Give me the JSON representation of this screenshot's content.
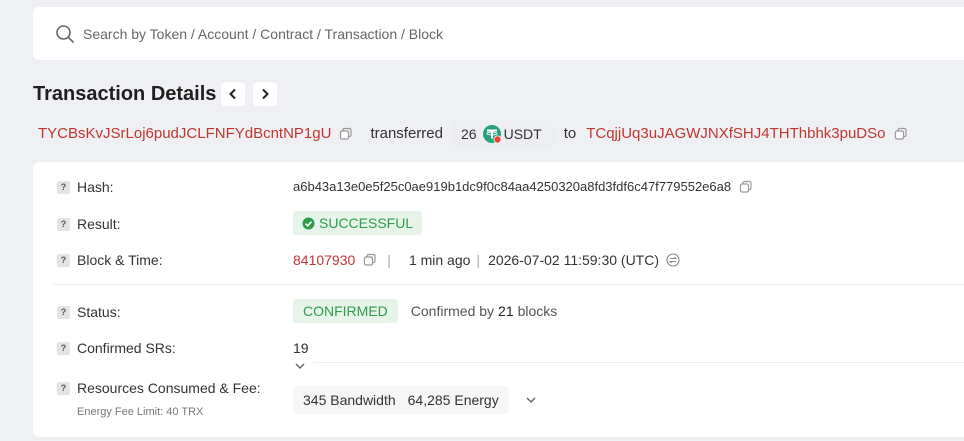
{
  "search": {
    "placeholder": "Search by Token / Account / Contract / Transaction / Block"
  },
  "page_title": "Transaction Details",
  "transfer": {
    "from_address": "TYCBsKvJSrLoj6pudJCLFNFYdBcntNP1gU",
    "verb": "transferred",
    "amount": "26",
    "token": "USDT",
    "to_word": "to",
    "to_address": "TCqjjUq3uJAGWJNXfSHJ4THThbhk3puDSo"
  },
  "details": {
    "hash_label": "Hash:",
    "hash_value": "a6b43a13e0e5f25c0ae919b1dc9f0c84aa4250320a8fd3fdf6c47f779552e6a8",
    "result_label": "Result:",
    "result_value": "SUCCESSFUL",
    "block_label": "Block & Time:",
    "block_number": "84107930",
    "time_ago": "1 min ago",
    "timestamp": "2026-07-02 11:59:30 (UTC)",
    "status_label": "Status:",
    "status_value": "CONFIRMED",
    "confirmed_by_prefix": "Confirmed by",
    "confirmed_by_count": "21",
    "confirmed_by_suffix": "blocks",
    "srs_label": "Confirmed SRs:",
    "srs_value": "19",
    "resources_label": "Resources Consumed & Fee:",
    "energy_fee_limit": "Energy Fee Limit: 40 TRX",
    "bandwidth": "345 Bandwidth",
    "energy": "64,285 Energy"
  },
  "colors": {
    "accent_red": "#c23631",
    "success_green": "#2e9d4a",
    "tether_teal": "#26a17b"
  },
  "icons": [
    "search-icon",
    "chevron-left-icon",
    "chevron-right-icon",
    "copy-icon",
    "usdt-token-icon",
    "question-icon",
    "check-circle-icon",
    "clock-convert-icon",
    "chevron-down-icon"
  ]
}
